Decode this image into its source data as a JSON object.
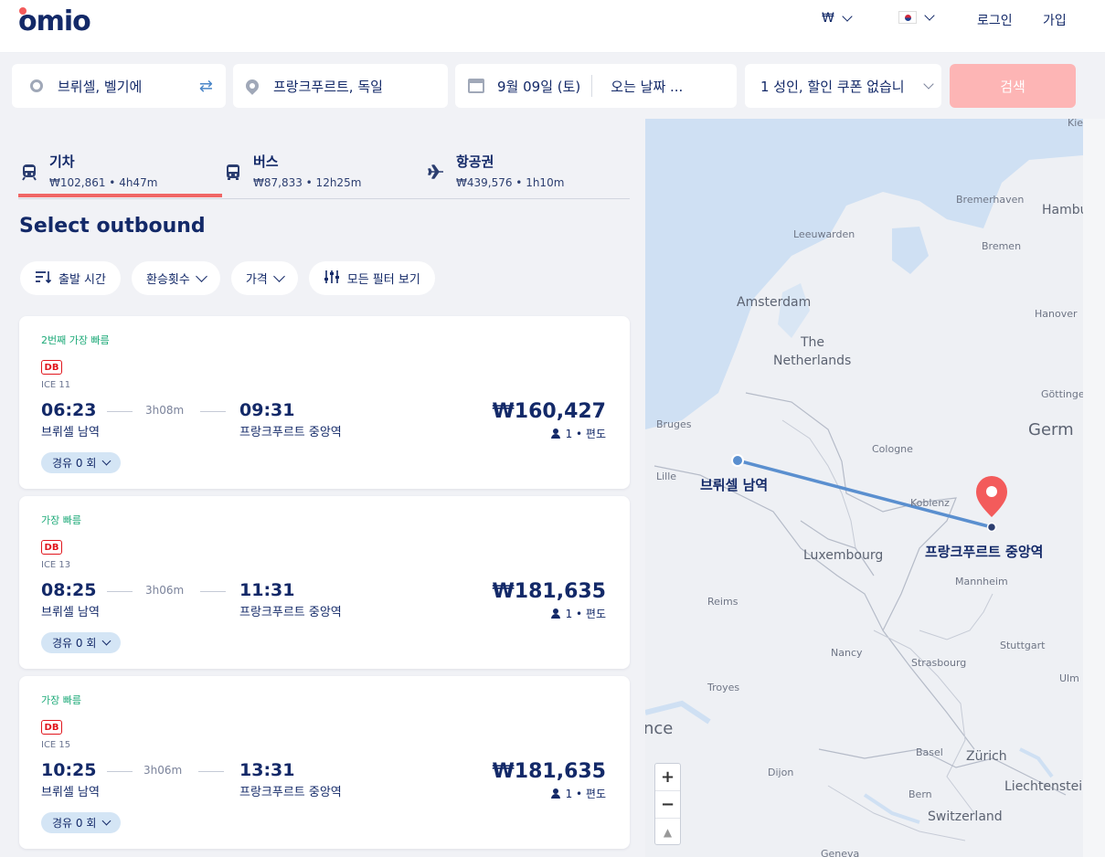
{
  "header": {
    "logo": "omio",
    "currency": "₩",
    "login": "로그인",
    "signup": "가입"
  },
  "search": {
    "origin": "브뤼셀, 벨기에",
    "destination": "프랑크푸르트, 독일",
    "depart_date": "9월 09일 (토)",
    "return_date": "오는 날짜 ...",
    "passengers": "1 성인, 할인 쿠폰 없습니",
    "search_button": "검색"
  },
  "tabs": [
    {
      "title": "기차",
      "sub": "₩102,861 • 4h47m",
      "icon": "train-icon"
    },
    {
      "title": "버스",
      "sub": "₩87,833 • 12h25m",
      "icon": "bus-icon"
    },
    {
      "title": "항공권",
      "sub": "₩439,576 • 1h10m",
      "icon": "plane-icon"
    }
  ],
  "section_title": "Select outbound",
  "filters": {
    "departure_time": "출발 시간",
    "transfers": "환승횟수",
    "price": "가격",
    "all_filters": "모든 필터 보기"
  },
  "results": [
    {
      "badge": "2번째 가장 빠름",
      "operator": "DB",
      "train": "ICE 11",
      "dep_time": "06:23",
      "duration": "3h08m",
      "arr_time": "09:31",
      "dep_station": "브뤼셀 남역",
      "arr_station": "프랑크푸르트 중앙역",
      "price": "₩160,427",
      "pax": "1 • 편도",
      "stops": "경유 0 회"
    },
    {
      "badge": "가장 빠름",
      "operator": "DB",
      "train": "ICE 13",
      "dep_time": "08:25",
      "duration": "3h06m",
      "arr_time": "11:31",
      "dep_station": "브뤼셀 남역",
      "arr_station": "프랑크푸르트 중앙역",
      "price": "₩181,635",
      "pax": "1 • 편도",
      "stops": "경유 0 회"
    },
    {
      "badge": "가장 빠름",
      "operator": "DB",
      "train": "ICE 15",
      "dep_time": "10:25",
      "duration": "3h06m",
      "arr_time": "13:31",
      "dep_station": "브뤼셀 남역",
      "arr_station": "프랑크푸르트 중앙역",
      "price": "₩181,635",
      "pax": "1 • 편도",
      "stops": "경유 0 회"
    }
  ],
  "map": {
    "origin_label": "브뤼셀 남역",
    "destination_label": "프랑크푸르트 중앙역",
    "places": [
      "Kie",
      "Bremerhaven",
      "Hambu",
      "Leeuwarden",
      "Bremen",
      "Amsterdam",
      "Hanover",
      "The",
      "Netherlands",
      "Göttinge",
      "Bruges",
      "Germ",
      "Cologne",
      "Lille",
      "Koblenz",
      "Luxembourg",
      "Mannheim",
      "Reims",
      "Stuttgart",
      "Nancy",
      "Strasbourg",
      "Troyes",
      "Ulm",
      "nce",
      "Basel",
      "Zürich",
      "Dijon",
      "Liechtenstein",
      "Bern",
      "Switzerland",
      "Geneva"
    ],
    "zoom_in": "+",
    "zoom_out": "−",
    "compass": "▲"
  },
  "colors": {
    "brand": "#132968",
    "accent": "#f06666",
    "search_button": "#fdb5b5",
    "route_line": "#5a8fcf",
    "badge": "#1eaa79",
    "db_red": "#e1151c"
  }
}
